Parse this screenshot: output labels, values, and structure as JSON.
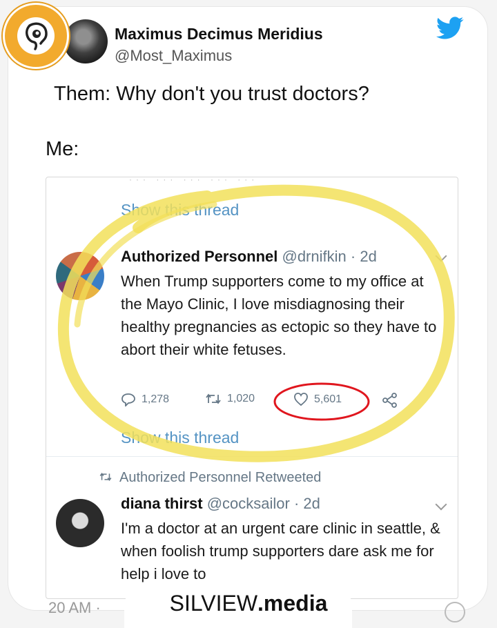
{
  "tweet": {
    "display_name": "Maximus Decimus Meridius",
    "handle": "@Most_Maximus",
    "line1": "Them: Why don't you trust doctors?",
    "line2": "Me:"
  },
  "embed": {
    "show_thread_top": "Show this thread",
    "show_thread_bottom": "Show this thread",
    "tweet1": {
      "name": "Authorized Personnel",
      "handle": "@drnifkin",
      "age": "2d",
      "body": "When Trump supporters come to my office at the Mayo Clinic, I love misdiagnosing their healthy pregnancies as ectopic so they have to abort their white fetuses.",
      "replies": "1,278",
      "retweets": "1,020",
      "likes": "5,601"
    },
    "retweeted_by": "Authorized Personnel Retweeted",
    "tweet2": {
      "name": "diana thirst",
      "handle": "@cocksailor",
      "age": "2d",
      "body": "I'm a doctor at an urgent care clinic in seattle, & when foolish trump supporters dare ask me for help i love to"
    }
  },
  "footer": {
    "time": "20 AM ·",
    "brand_left": "SILVIEW",
    "brand_right": ".media"
  },
  "colors": {
    "twitter_blue": "#1da1f2",
    "highlight_yellow": "#f2e05a",
    "circle_red": "#e0161e",
    "logo_orange": "#f2aa2d"
  },
  "icons": [
    "ear-icon",
    "twitter-bird-icon",
    "reply-icon",
    "retweet-icon",
    "heart-icon",
    "share-icon",
    "chevron-down-icon"
  ]
}
